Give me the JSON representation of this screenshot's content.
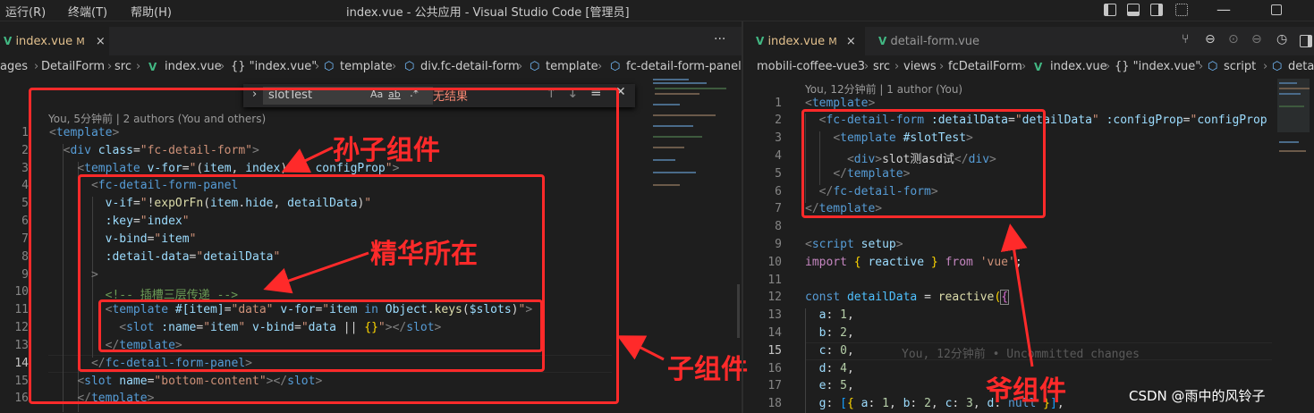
{
  "titlebar": {
    "menu": [
      "运行(R)",
      "终端(T)",
      "帮助(H)"
    ],
    "title": "index.vue - 公共应用 - Visual Studio Code [管理员]"
  },
  "left": {
    "tab": {
      "label": "index.vue",
      "status": "M",
      "close": "×"
    },
    "more": "···",
    "breadcrumb": [
      "ages",
      "DetailForm",
      "src",
      "index.vue",
      "{} \"index.vue\"",
      "template",
      "div.fc-detail-form",
      "template",
      "fc-detail-form-panel"
    ],
    "find": {
      "value": "slotTest",
      "aa": "Aa",
      "ab": "ab",
      "regex": ".*",
      "result": "无结果"
    },
    "blame": "You, 5分钟前 | 2 authors (You and others)",
    "line_numbers": [
      "1",
      "2",
      "3",
      "4",
      "5",
      "6",
      "7",
      "8",
      "9",
      "10",
      "11",
      "12",
      "13",
      "14",
      "15",
      "16"
    ],
    "annotations": {
      "grandchild": "孙子组件",
      "essence": "精华所在",
      "child": "子组件"
    }
  },
  "right": {
    "tabs": [
      {
        "label": "index.vue",
        "status": "M",
        "close": "×"
      },
      {
        "label": "detail-form.vue"
      }
    ],
    "breadcrumb": [
      "mobili-coffee-vue3",
      "src",
      "views",
      "fcDetailForm",
      "index.vue",
      "{} \"index.vue\"",
      "script",
      "detai"
    ],
    "blame": "You, 12分钟前 | 1 author (You)",
    "line_numbers": [
      "1",
      "2",
      "3",
      "4",
      "5",
      "6",
      "7",
      "8",
      "9",
      "10",
      "11",
      "12",
      "13",
      "14",
      "15",
      "16",
      "17",
      "18"
    ],
    "inline_blame": "You, 12分钟前 • Uncommitted changes",
    "annotations": {
      "grandparent": "爷组件"
    }
  },
  "watermark": "CSDN @雨中的风铃子"
}
